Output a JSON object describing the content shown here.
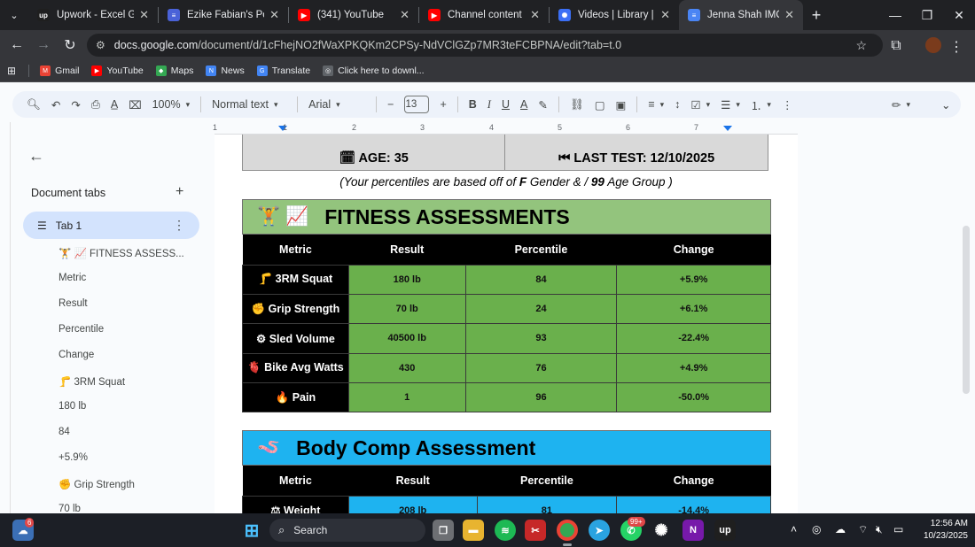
{
  "browser": {
    "tabs": [
      {
        "title": "Upwork - Excel Goog",
        "favicon": "upwork-icon",
        "color": "#1f1f1f",
        "glyph": "up"
      },
      {
        "title": "Ezike Fabian's Portfoli",
        "favicon": "docs-icon",
        "color": "#4a62d8",
        "glyph": "≡"
      },
      {
        "title": "(341) YouTube",
        "favicon": "youtube-icon",
        "color": "#ff0000",
        "glyph": "▶"
      },
      {
        "title": "Channel content - Yo",
        "favicon": "youtube-icon",
        "color": "#ff0000",
        "glyph": "▶"
      },
      {
        "title": "Videos | Library | Loo",
        "favicon": "loom-icon",
        "color": "#3b6ff5",
        "glyph": "✺"
      },
      {
        "title": "Jenna Shah IMOC Fit",
        "favicon": "docs-icon",
        "color": "#4a85f4",
        "glyph": "≡"
      }
    ],
    "url_host": "docs.google.com",
    "url_path": "/document/d/1cFhejNO2fWaXPKQKm2CPSy-NdVClGZp7MR3teFCBPNA/edit?tab=t.0",
    "bookmarks": [
      {
        "label": "Gmail",
        "icon": "gmail-icon",
        "color": "#ea4335",
        "glyph": "M"
      },
      {
        "label": "YouTube",
        "icon": "youtube-icon",
        "color": "#ff0000",
        "glyph": "▶"
      },
      {
        "label": "Maps",
        "icon": "maps-icon",
        "color": "#34a853",
        "glyph": "◆"
      },
      {
        "label": "News",
        "icon": "news-icon",
        "color": "#4285f4",
        "glyph": "N"
      },
      {
        "label": "Translate",
        "icon": "translate-icon",
        "color": "#4285f4",
        "glyph": "G"
      },
      {
        "label": "Click here to downl...",
        "icon": "globe-icon",
        "color": "#5f6368",
        "glyph": "◎"
      }
    ]
  },
  "toolbar": {
    "zoom": "100%",
    "style": "Normal text",
    "font": "Arial",
    "font_size": "13"
  },
  "ruler": {
    "numbers": [
      "1",
      "1",
      "2",
      "3",
      "4",
      "5",
      "6",
      "7"
    ]
  },
  "sidebar": {
    "title": "Document tabs",
    "tab_label": "Tab 1",
    "outline": [
      "🏋 📈 FITNESS ASSESS...",
      "Metric",
      "Result",
      "Percentile",
      "Change",
      "🦵 3RM Squat",
      "180 lb",
      "84",
      "+5.9%",
      "✊ Grip Strength",
      "70 lb"
    ]
  },
  "doc": {
    "age": "🗓 AGE: 35",
    "last_test": "⏮ LAST TEST: 12/10/2025",
    "note_prefix": "(Your percentiles are based off of ",
    "note_gender": "F",
    "note_mid": " Gender & / ",
    "note_age": "99",
    "note_suffix": " Age Group )",
    "fitness": {
      "emoji": "🏋📈",
      "title": "FITNESS ASSESSMENTS",
      "header_color": "#93c47d",
      "columns": [
        "Metric",
        "Result",
        "Percentile",
        "Change"
      ],
      "rows": [
        {
          "metric": "🦵 3RM Squat",
          "result": "180 lb",
          "percentile": "84",
          "change": "+5.9%"
        },
        {
          "metric": "✊ Grip Strength",
          "result": "70 lb",
          "percentile": "24",
          "change": "+6.1%"
        },
        {
          "metric": "⚙ Sled Volume",
          "result": "40500 lb",
          "percentile": "93",
          "change": "-22.4%"
        },
        {
          "metric": "🫀 Bike Avg Watts",
          "result": "430",
          "percentile": "76",
          "change": "+4.9%"
        },
        {
          "metric": "🔥 Pain",
          "result": "1",
          "percentile": "96",
          "change": "-50.0%"
        }
      ]
    },
    "body": {
      "emoji": "🪱",
      "title": "Body Comp Assessment",
      "header_color": "#1eb3f0",
      "columns": [
        "Metric",
        "Result",
        "Percentile",
        "Change"
      ],
      "rows": [
        {
          "metric": "⚖ Weight",
          "result": "208 lb",
          "percentile": "81",
          "change": "-14.4%"
        }
      ]
    }
  },
  "taskbar": {
    "search_placeholder": "Search",
    "time": "12:56 AM",
    "date": "10/23/2025",
    "weather_badge": "6",
    "whatsapp_badge": "99+"
  }
}
